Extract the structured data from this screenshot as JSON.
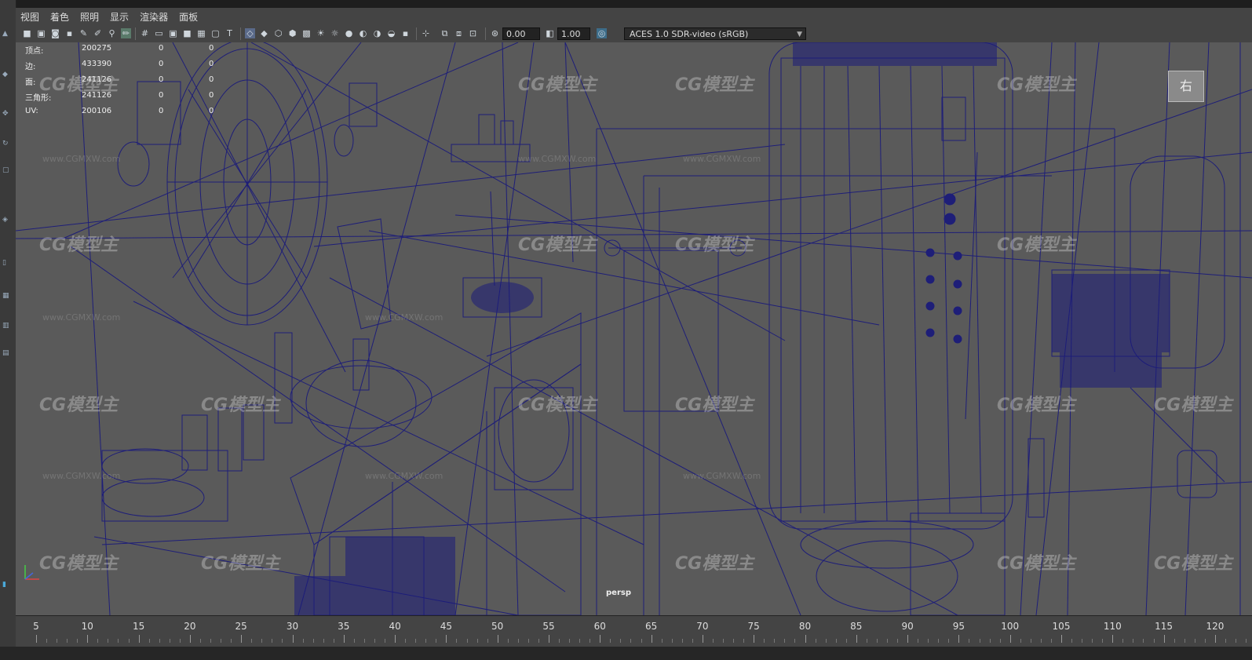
{
  "menubar": {
    "items": [
      "视图",
      "着色",
      "照明",
      "显示",
      "渲染器",
      "面板"
    ]
  },
  "toolbar": {
    "field1_value": "0.00",
    "field2_value": "1.00",
    "colorspace": "ACES 1.0 SDR-video (sRGB)"
  },
  "hud": {
    "rows": [
      {
        "label": "顶点:",
        "value": "200275",
        "c1": "0",
        "c2": "0"
      },
      {
        "label": "边:",
        "value": "433390",
        "c1": "0",
        "c2": "0"
      },
      {
        "label": "面:",
        "value": "241126",
        "c1": "0",
        "c2": "0"
      },
      {
        "label": "三角形:",
        "value": "241126",
        "c1": "0",
        "c2": "0"
      },
      {
        "label": "UV:",
        "value": "200106",
        "c1": "0",
        "c2": "0"
      }
    ]
  },
  "viewport": {
    "camera": "persp",
    "viewcube_face": "右",
    "axis_x": "x",
    "axis_y": "y",
    "axis_z": "z",
    "wire_color": "#1b1b7a",
    "background": "#5a5a5a"
  },
  "watermark": {
    "brand": "CG模型主",
    "url": "www.CGMXW.com"
  },
  "timeline": {
    "ticks": [
      "5",
      "10",
      "15",
      "20",
      "25",
      "30",
      "35",
      "40",
      "45",
      "50",
      "55",
      "60",
      "65",
      "70",
      "75",
      "80",
      "85",
      "90",
      "95",
      "100",
      "105",
      "110",
      "115",
      "120"
    ]
  },
  "icons": [
    "camera-icon",
    "grid-icon",
    "shading-icon",
    "light-icon",
    "isolate-icon",
    "exposure-icon",
    "gamma-icon",
    "colorspace-icon"
  ]
}
